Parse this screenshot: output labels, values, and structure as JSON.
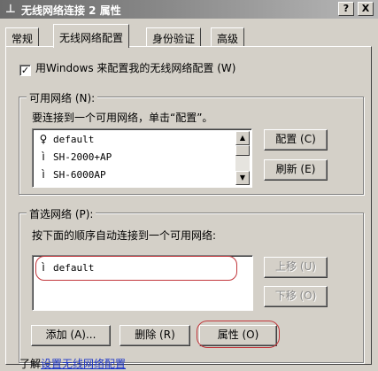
{
  "window": {
    "title": "无线网络连接 2 属性",
    "help_btn": "?",
    "close_btn": "X"
  },
  "tabs": [
    {
      "label": "常规"
    },
    {
      "label": "无线网络配置"
    },
    {
      "label": "身份验证"
    },
    {
      "label": "高级"
    }
  ],
  "use_windows_checkbox": {
    "checked": true,
    "label": "用Windows 来配置我的无线网络配置 (W)"
  },
  "available_networks": {
    "title": "可用网络 (N):",
    "description": "要连接到一个可用网络，单击“配置”。",
    "items": [
      {
        "icon": "antenna-icon",
        "name": "default"
      },
      {
        "icon": "signal-icon",
        "name": "SH-2000+AP"
      },
      {
        "icon": "signal-icon",
        "name": "SH-6000AP"
      }
    ],
    "configure_btn": "配置 (C)",
    "refresh_btn": "刷新 (E)"
  },
  "preferred_networks": {
    "title": "首选网络 (P):",
    "description": "按下面的顺序自动连接到一个可用网络:",
    "items": [
      {
        "icon": "signal-icon",
        "name": "default"
      }
    ],
    "move_up_btn": "上移 (U)",
    "move_down_btn": "下移 (O)",
    "add_btn": "添加 (A)...",
    "remove_btn": "删除 (R)",
    "properties_btn": "属性 (O)"
  },
  "footer_link": {
    "prefix": "了解",
    "link_text": "设置无线网络配置"
  },
  "colors": {
    "highlight_circle": "#c2373c",
    "link": "#1a33c8"
  }
}
